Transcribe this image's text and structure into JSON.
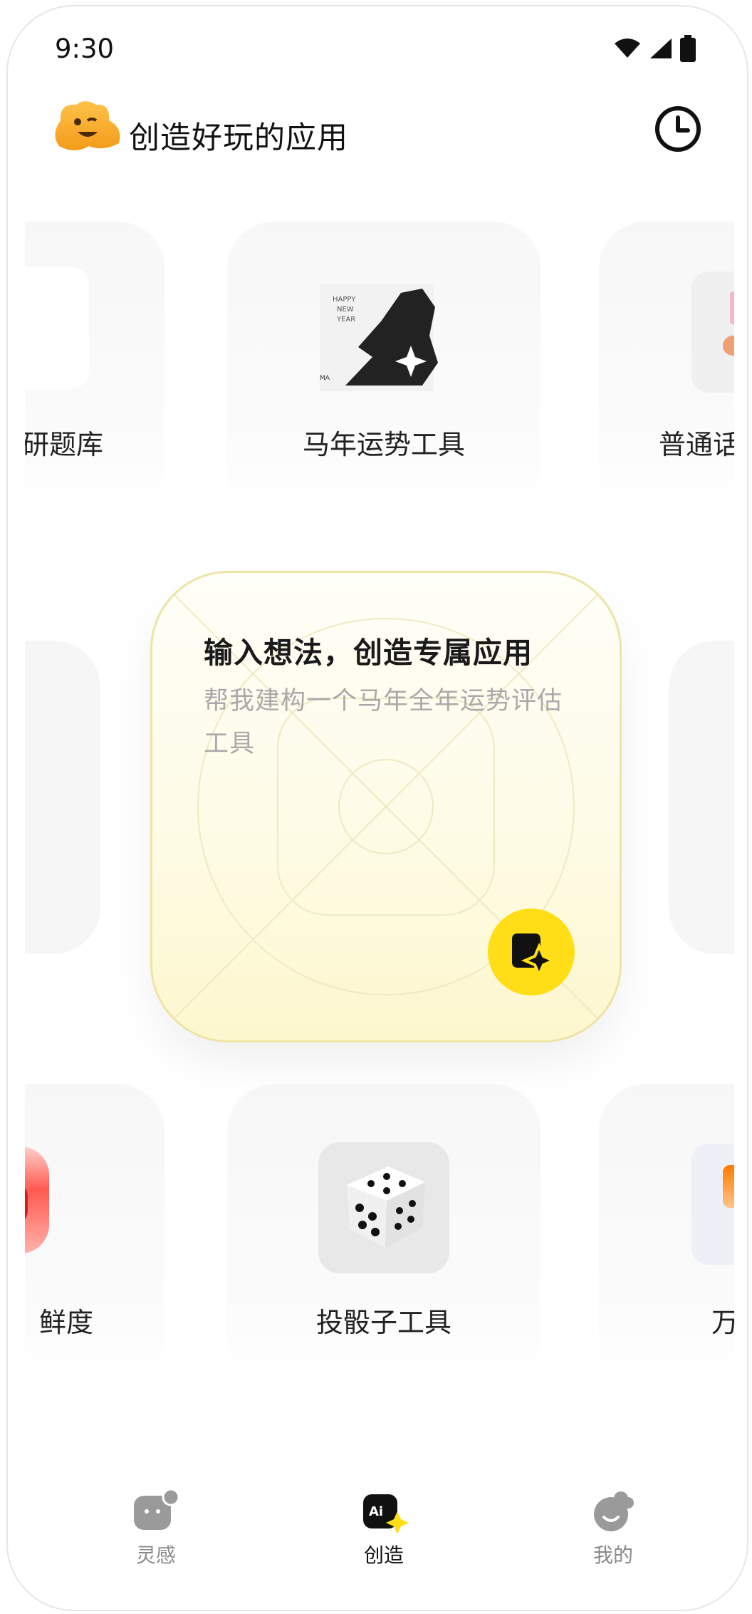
{
  "status_bar": {
    "time": "9:30"
  },
  "header": {
    "title": "创造好玩的应用"
  },
  "row1": {
    "left_label": "研题库",
    "center_label": "马年运势工具",
    "right_label": "普通话"
  },
  "idea": {
    "title": "输入想法，创造专属应用",
    "placeholder": "帮我建构一个马年全年运势评估工具"
  },
  "row3": {
    "left_label": "鲜度",
    "center_label": "投骰子工具",
    "right_label": "万"
  },
  "tabs": [
    {
      "label": "灵感",
      "icon": "inspiration-icon",
      "active": false
    },
    {
      "label": "创造",
      "icon": "ai-create-icon",
      "active": true
    },
    {
      "label": "我的",
      "icon": "profile-icon",
      "active": false
    }
  ],
  "colors": {
    "accent": "#ffde17",
    "active_tab": "#111111",
    "inactive_tab": "#8a8a8a"
  }
}
